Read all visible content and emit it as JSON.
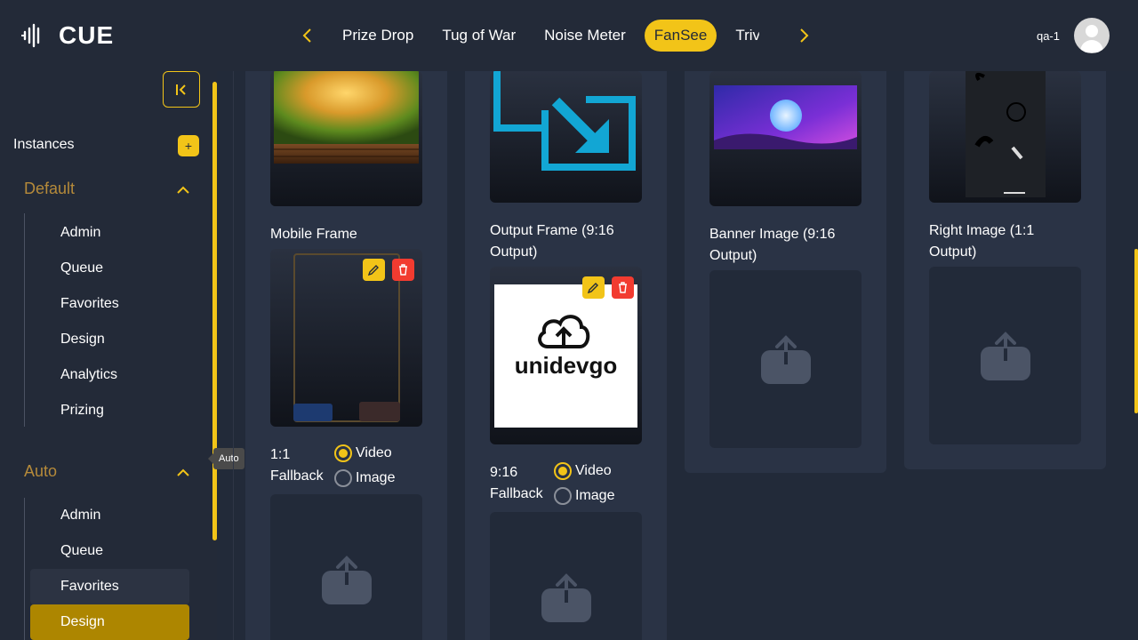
{
  "header": {
    "logo_text": "CUE",
    "nav_prev_icon": "chevron-left-icon",
    "nav_next_icon": "chevron-right-icon",
    "tabs": [
      {
        "label": "Prize Drop"
      },
      {
        "label": "Tug of War"
      },
      {
        "label": "Noise Meter"
      },
      {
        "label": "FanSee",
        "active": true
      },
      {
        "label": "Trivia"
      }
    ],
    "username": "qa-1",
    "accent_color": "#f2c418"
  },
  "sidebar": {
    "collapse_icon": "collapse-left-icon",
    "instances_label": "Instances",
    "add_label": "+",
    "groups": [
      {
        "title": "Default",
        "items": [
          {
            "label": "Admin"
          },
          {
            "label": "Queue"
          },
          {
            "label": "Favorites"
          },
          {
            "label": "Design"
          },
          {
            "label": "Analytics"
          },
          {
            "label": "Prizing"
          }
        ]
      },
      {
        "title": "Auto",
        "items": [
          {
            "label": "Admin"
          },
          {
            "label": "Queue"
          },
          {
            "label": "Favorites"
          },
          {
            "label": "Design",
            "active": true
          }
        ]
      }
    ],
    "tooltip": "Auto"
  },
  "main": {
    "col1": {
      "mobile_frame_label": "Mobile Frame",
      "fallback_label_1": "1:1",
      "fallback_label_2": "Fallback",
      "radio_video": "Video",
      "radio_image": "Image",
      "selected": "Video"
    },
    "col2": {
      "output_frame_label": "Output Frame (9:16 Output)",
      "preview_text": "unidevgo",
      "fallback_label_1": "9:16",
      "fallback_label_2": "Fallback",
      "radio_video": "Video",
      "radio_image": "Image",
      "selected": "Video"
    },
    "col3": {
      "banner_label": "Banner Image (9:16 Output)"
    },
    "col4": {
      "right_image_label": "Right Image (1:1 Output)"
    }
  }
}
